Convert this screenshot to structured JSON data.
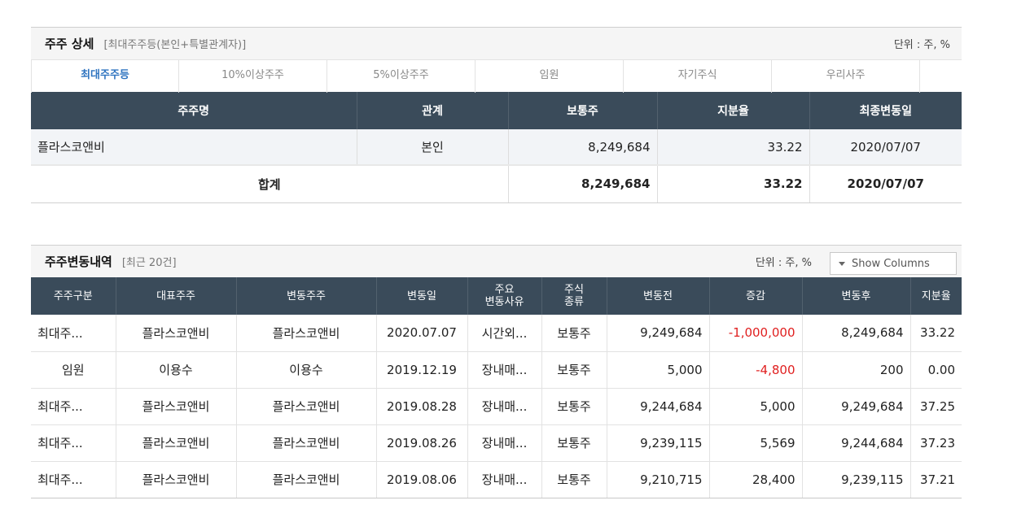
{
  "section1": {
    "title": "주주 상세",
    "subtitle": "[최대주주등(본인+특별관계자)]",
    "unit": "단위 : 주, %",
    "tabs": [
      {
        "label": "최대주주등"
      },
      {
        "label": "10%이상주주"
      },
      {
        "label": "5%이상주주"
      },
      {
        "label": "임원"
      },
      {
        "label": "자기주식"
      },
      {
        "label": "우리사주"
      }
    ],
    "columns": [
      "주주명",
      "관계",
      "보통주",
      "지분율",
      "최종변동일"
    ],
    "rows": [
      {
        "name": "플라스코앤비",
        "relation": "본인",
        "common": "8,249,684",
        "ratio": "33.22",
        "date": "2020/07/07"
      }
    ],
    "total": {
      "label": "합계",
      "common": "8,249,684",
      "ratio": "33.22",
      "date": "2020/07/07"
    }
  },
  "section2": {
    "title": "주주변동내역",
    "subtitle": "[최근 20건]",
    "unit": "단위 : 주, %",
    "show_columns": "Show Columns",
    "columns": {
      "type": "주주구분",
      "rep": "대표주주",
      "holder": "변동주주",
      "date": "변동일",
      "reason_1": "주요",
      "reason_2": "변동사유",
      "kind_1": "주식",
      "kind_2": "종류",
      "before": "변동전",
      "change": "증감",
      "after": "변동후",
      "ratio": "지분율"
    },
    "rows": [
      {
        "type": "최대주...",
        "rep": "플라스코앤비",
        "holder": "플라스코앤비",
        "date": "2020.07.07",
        "reason": "시간외...",
        "kind": "보통주",
        "before": "9,249,684",
        "change": "-1,000,000",
        "after": "8,249,684",
        "ratio": "33.22"
      },
      {
        "type": "임원",
        "rep": "이용수",
        "holder": "이용수",
        "date": "2019.12.19",
        "reason": "장내매...",
        "kind": "보통주",
        "before": "5,000",
        "change": "-4,800",
        "after": "200",
        "ratio": "0.00"
      },
      {
        "type": "최대주...",
        "rep": "플라스코앤비",
        "holder": "플라스코앤비",
        "date": "2019.08.28",
        "reason": "장내매...",
        "kind": "보통주",
        "before": "9,244,684",
        "change": "5,000",
        "after": "9,249,684",
        "ratio": "37.25"
      },
      {
        "type": "최대주...",
        "rep": "플라스코앤비",
        "holder": "플라스코앤비",
        "date": "2019.08.26",
        "reason": "장내매...",
        "kind": "보통주",
        "before": "9,239,115",
        "change": "5,569",
        "after": "9,244,684",
        "ratio": "37.23"
      },
      {
        "type": "최대주...",
        "rep": "플라스코앤비",
        "holder": "플라스코앤비",
        "date": "2019.08.06",
        "reason": "장내매...",
        "kind": "보통주",
        "before": "9,210,715",
        "change": "28,400",
        "after": "9,239,115",
        "ratio": "37.21"
      }
    ]
  },
  "colors": {
    "header_bg": "#3a4b5a",
    "active_tab": "#2f74c0",
    "negative": "#e02020",
    "row_bg": "#f2f4f7"
  }
}
